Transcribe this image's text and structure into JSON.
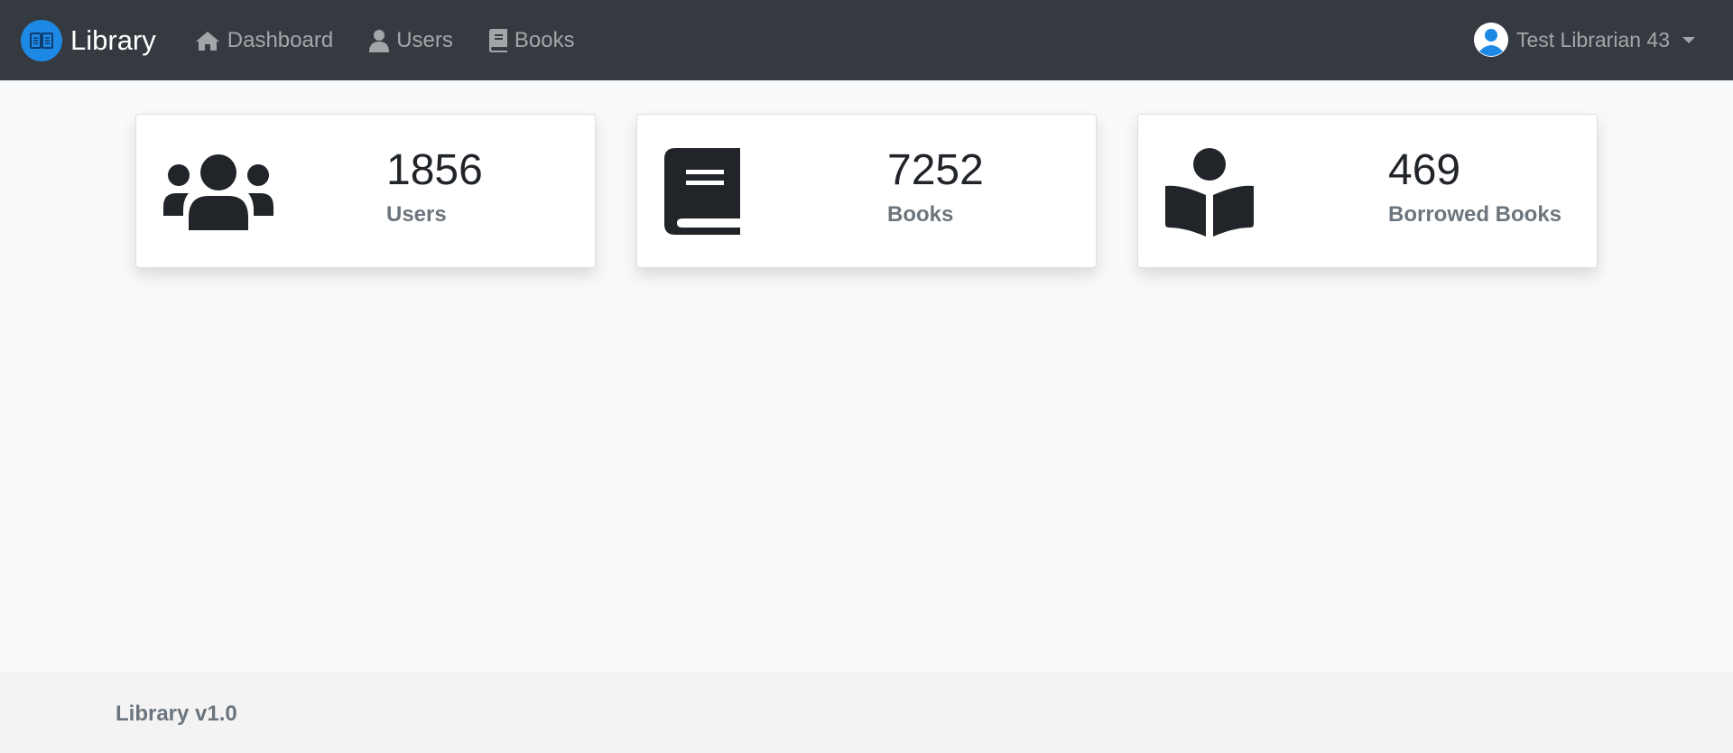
{
  "navbar": {
    "brand": "Library",
    "links": [
      {
        "label": "Dashboard",
        "icon": "home-icon"
      },
      {
        "label": "Users",
        "icon": "user-icon"
      },
      {
        "label": "Books",
        "icon": "book-icon"
      }
    ],
    "user": {
      "name": "Test Librarian 43",
      "icon": "avatar-icon"
    }
  },
  "cards": [
    {
      "value": "1856",
      "label": "Users",
      "icon": "users-group-icon"
    },
    {
      "value": "7252",
      "label": "Books",
      "icon": "book-icon"
    },
    {
      "value": "469",
      "label": "Borrowed Books",
      "icon": "book-reader-icon"
    }
  ],
  "footer": {
    "text": "Library v1.0"
  },
  "colors": {
    "navbar_bg": "#343a40",
    "brand_logo": "#1e88e5",
    "page_bg": "#f8f9fa"
  }
}
